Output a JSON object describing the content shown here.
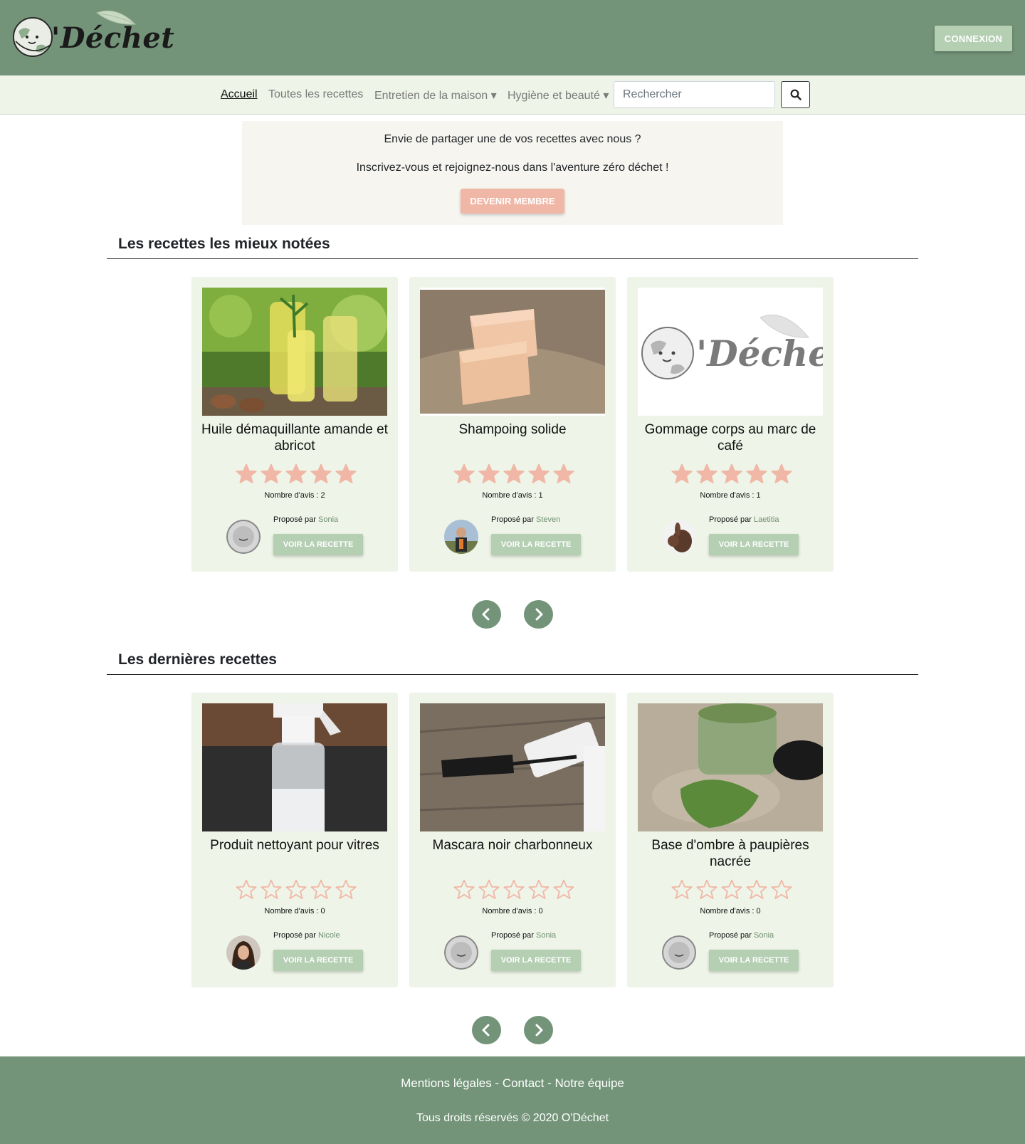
{
  "header": {
    "logo_text": "'Déchet",
    "login_label": "CONNEXION"
  },
  "nav": {
    "items": [
      "Accueil",
      "Toutes les recettes",
      "Entretien de la maison ▾",
      "Hygiène et beauté ▾"
    ],
    "search_placeholder": "Rechercher"
  },
  "promo": {
    "line1": "Envie de partager une de vos recettes avec nous ?",
    "line2": "Inscrivez-vous et rejoignez-nous dans l'aventure zéro déchet !",
    "button": "DEVENIR MEMBRE"
  },
  "sections": [
    {
      "title": "Les recettes les mieux notées",
      "cards": [
        {
          "title": "Huile démaquillante amande et abricot",
          "rating": 5,
          "reviews": "Nombre d'avis : 2",
          "proposed": "Proposé par",
          "author": "Sonia",
          "button": "VOIR LA RECETTE"
        },
        {
          "title": "Shampoing solide",
          "rating": 5,
          "reviews": "Nombre d'avis : 1",
          "proposed": "Proposé par",
          "author": "Steven",
          "button": "VOIR LA RECETTE"
        },
        {
          "title": "Gommage corps au marc de café",
          "rating": 5,
          "reviews": "Nombre d'avis : 1",
          "proposed": "Proposé par",
          "author": "Laetitia",
          "button": "VOIR LA RECETTE"
        }
      ]
    },
    {
      "title": "Les dernières recettes",
      "cards": [
        {
          "title": "Produit nettoyant pour vitres",
          "rating": 0,
          "reviews": "Nombre d'avis : 0",
          "proposed": "Proposé par",
          "author": "Nicole",
          "button": "VOIR LA RECETTE"
        },
        {
          "title": "Mascara noir charbonneux",
          "rating": 0,
          "reviews": "Nombre d'avis : 0",
          "proposed": "Proposé par",
          "author": "Sonia",
          "button": "VOIR LA RECETTE"
        },
        {
          "title": "Base d'ombre à paupières nacrée",
          "rating": 0,
          "reviews": "Nombre d'avis : 0",
          "proposed": "Proposé par",
          "author": "Sonia",
          "button": "VOIR LA RECETTE"
        }
      ]
    }
  ],
  "footer": {
    "links": [
      "Mentions légales",
      "Contact",
      "Notre équipe"
    ],
    "separator": " - ",
    "copyright": "Tous droits réservés © 2020 O'Déchet"
  },
  "colors": {
    "header_green": "#739479",
    "light_green": "#eef4e7",
    "button_green": "#b5cfb3",
    "star_pink": "#f1b7a6"
  }
}
